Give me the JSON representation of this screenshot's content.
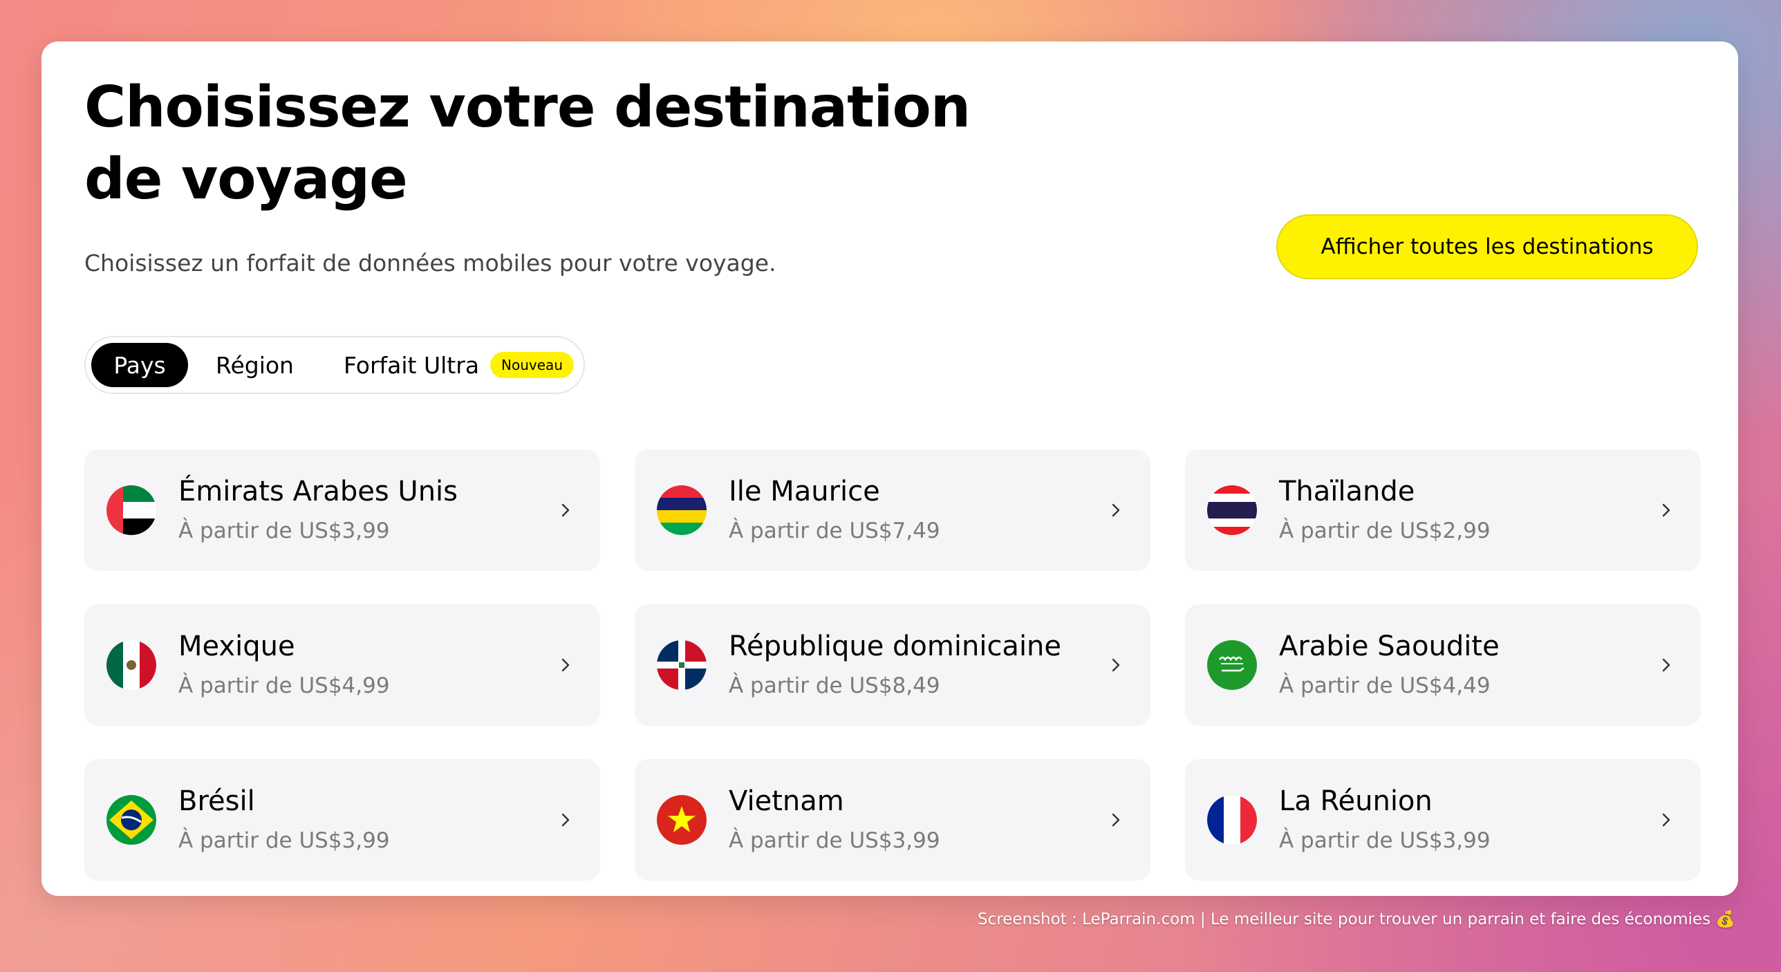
{
  "header": {
    "title": "Choisissez votre destination de voyage",
    "subtitle": "Choisissez un forfait de données mobiles pour votre voyage.",
    "all_destinations_label": "Afficher toutes les destinations"
  },
  "tabs": {
    "pays": "Pays",
    "region": "Région",
    "ultra": "Forfait Ultra",
    "ultra_badge": "Nouveau"
  },
  "destinations": [
    {
      "name": "Émirats Arabes Unis",
      "price": "À partir de US$3,99",
      "flag": "uae-flag-icon"
    },
    {
      "name": "Ile Maurice",
      "price": "À partir de US$7,49",
      "flag": "mauritius-flag-icon"
    },
    {
      "name": "Thaïlande",
      "price": "À partir de US$2,99",
      "flag": "thailand-flag-icon"
    },
    {
      "name": "Mexique",
      "price": "À partir de US$4,99",
      "flag": "mexico-flag-icon"
    },
    {
      "name": "République dominicaine",
      "price": "À partir de US$8,49",
      "flag": "dominican-republic-flag-icon"
    },
    {
      "name": "Arabie Saoudite",
      "price": "À partir de US$4,49",
      "flag": "saudi-arabia-flag-icon"
    },
    {
      "name": "Brésil",
      "price": "À partir de US$3,99",
      "flag": "brazil-flag-icon"
    },
    {
      "name": "Vietnam",
      "price": "À partir de US$3,99",
      "flag": "vietnam-flag-icon"
    },
    {
      "name": "La Réunion",
      "price": "À partir de US$3,99",
      "flag": "france-flag-icon"
    }
  ],
  "watermark": "Screenshot : LeParrain.com | Le meilleur site pour trouver un parrain et faire des économies 💰",
  "colors": {
    "accent_yellow": "#fff200",
    "active_tab": "#000000",
    "card_bg": "#f5f5f7"
  }
}
